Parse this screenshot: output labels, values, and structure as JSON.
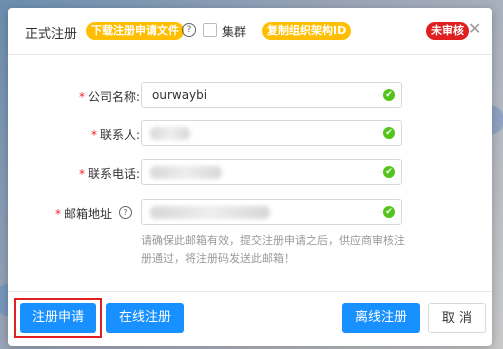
{
  "header": {
    "title": "正式注册",
    "download_label": "下载注册申请文件",
    "help_glyph": "?",
    "checkbox_label": "集群",
    "copy_label": "复制组织架构ID",
    "status_badge": "未审核",
    "close_glyph": "✕"
  },
  "form": {
    "company": {
      "label": "公司名称:",
      "value": "ourwaybi"
    },
    "contact": {
      "label": "联系人:",
      "value": ""
    },
    "phone": {
      "label": "联系电话:",
      "value": ""
    },
    "email": {
      "label": "邮箱地址",
      "value": ""
    },
    "required_mark": "*",
    "email_hint": "请确保此邮箱有效，提交注册申请之后，供应商审核注册通过，将注册码发送此邮箱！"
  },
  "footer": {
    "register_label": "注册申请",
    "online_label": "在线注册",
    "offline_label": "离线注册",
    "cancel_label": "取 消"
  },
  "colors": {
    "primary": "#1890ff",
    "accent": "#ffbf00",
    "danger": "#e02020",
    "success": "#52c41a"
  }
}
